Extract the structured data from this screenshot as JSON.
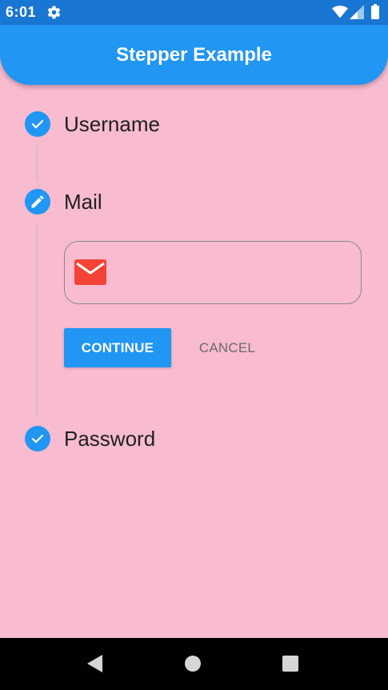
{
  "status_bar": {
    "time": "6:01",
    "icons": [
      "gear-icon",
      "wifi-icon",
      "signal-icon",
      "battery-icon"
    ]
  },
  "app_bar": {
    "title": "Stepper Example",
    "color": "#2196F3"
  },
  "stepper": {
    "steps": [
      {
        "title": "Username",
        "state": "complete",
        "icon": "check-icon"
      },
      {
        "title": "Mail",
        "state": "editing",
        "icon": "pencil-icon"
      },
      {
        "title": "Password",
        "state": "complete",
        "icon": "check-icon"
      }
    ],
    "active_step": {
      "field": {
        "icon": "mail-icon",
        "value": "",
        "placeholder": ""
      },
      "continue_label": "CONTINUE",
      "cancel_label": "CANCEL"
    }
  },
  "colors": {
    "background": "#F8BBD0",
    "accent": "#2196F3",
    "status_bar": "#1976D2",
    "mail_icon": "#F44336"
  },
  "nav_bar": {
    "icons": [
      "back-icon",
      "home-icon",
      "recents-icon"
    ]
  }
}
